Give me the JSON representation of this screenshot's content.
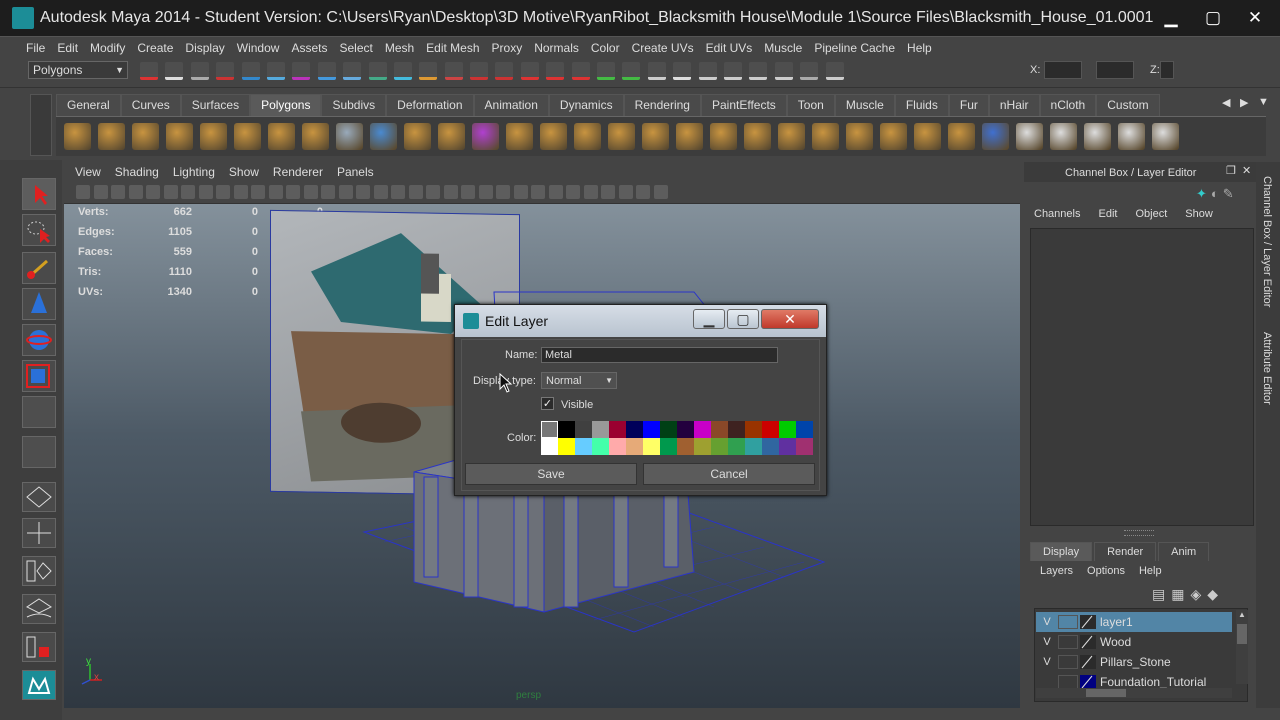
{
  "window": {
    "title": "Autodesk Maya 2014 - Student Version: C:\\Users\\Ryan\\Desktop\\3D Motive\\RyanRibot_Blacksmith House\\Module 1\\Source Files\\Blacksmith_House_01.0001.mb*",
    "min": "▁",
    "max": "▢",
    "close": "✕"
  },
  "menubar": [
    "File",
    "Edit",
    "Modify",
    "Create",
    "Display",
    "Window",
    "Assets",
    "Select",
    "Mesh",
    "Edit Mesh",
    "Proxy",
    "Normals",
    "Color",
    "Create UVs",
    "Edit UVs",
    "Muscle",
    "Pipeline Cache",
    "Help"
  ],
  "statusline": {
    "mode": "Polygons",
    "x_label": "X:",
    "y_label": "Y:",
    "z_label": "Z:"
  },
  "shelf_tabs": [
    "General",
    "Curves",
    "Surfaces",
    "Polygons",
    "Subdivs",
    "Deformation",
    "Animation",
    "Dynamics",
    "Rendering",
    "PaintEffects",
    "Toon",
    "Muscle",
    "Fluids",
    "Fur",
    "nHair",
    "nCloth",
    "Custom"
  ],
  "shelf_active": "Polygons",
  "viewport": {
    "menu": [
      "View",
      "Shading",
      "Lighting",
      "Show",
      "Renderer",
      "Panels"
    ],
    "hud": [
      {
        "label": "Verts:",
        "v1": "662",
        "v2": "0",
        "v3": "0"
      },
      {
        "label": "Edges:",
        "v1": "1105",
        "v2": "0",
        "v3": "0"
      },
      {
        "label": "Faces:",
        "v1": "559",
        "v2": "0",
        "v3": "0"
      },
      {
        "label": "Tris:",
        "v1": "1110",
        "v2": "0",
        "v3": "0"
      },
      {
        "label": "UVs:",
        "v1": "1340",
        "v2": "0",
        "v3": "0"
      }
    ],
    "camera_label": "persp",
    "axis_y": "y",
    "axis_x": "x"
  },
  "dialog": {
    "title": "Edit Layer",
    "name_label": "Name:",
    "name_value": "Metal",
    "display_type_label": "Display type:",
    "display_type_value": "Normal",
    "visible_label": "Visible",
    "visible_checked": true,
    "color_label": "Color:",
    "save": "Save",
    "cancel": "Cancel",
    "colors": [
      "#777777",
      "#000000",
      "#404040",
      "#999999",
      "#9b0030",
      "#00005a",
      "#0000ff",
      "#004015",
      "#23003e",
      "#c800c8",
      "#8a4828",
      "#3e2220",
      "#993300",
      "#cc0000",
      "#00cc00",
      "#0044aa",
      "#ffffff",
      "#ffff00",
      "#66ccff",
      "#44ffaa",
      "#ffaaaa",
      "#e6aa78",
      "#ffff66",
      "#00994d",
      "#a06030",
      "#9ea030",
      "#66a030",
      "#30a050",
      "#30a0a0",
      "#3066a0",
      "#6030a0",
      "#a03070"
    ]
  },
  "right_panel": {
    "header": "Channel Box / Layer Editor",
    "menu": [
      "Channels",
      "Edit",
      "Object",
      "Show"
    ],
    "tabs": [
      "Display",
      "Render",
      "Anim"
    ],
    "active_tab": "Display",
    "submenu": [
      "Layers",
      "Options",
      "Help"
    ],
    "layers": [
      {
        "v": "V",
        "name": "layer1",
        "selected": true,
        "color": "#2b2b2b"
      },
      {
        "v": "V",
        "name": "Wood",
        "selected": false,
        "color": "#2b2b2b"
      },
      {
        "v": "V",
        "name": "Pillars_Stone",
        "selected": false,
        "color": "#2b2b2b"
      },
      {
        "v": "",
        "name": "Foundation_Tutorial",
        "selected": false,
        "color": "#000080"
      }
    ],
    "side_tabs": [
      "Channel Box / Layer Editor",
      "Attribute Editor"
    ]
  }
}
